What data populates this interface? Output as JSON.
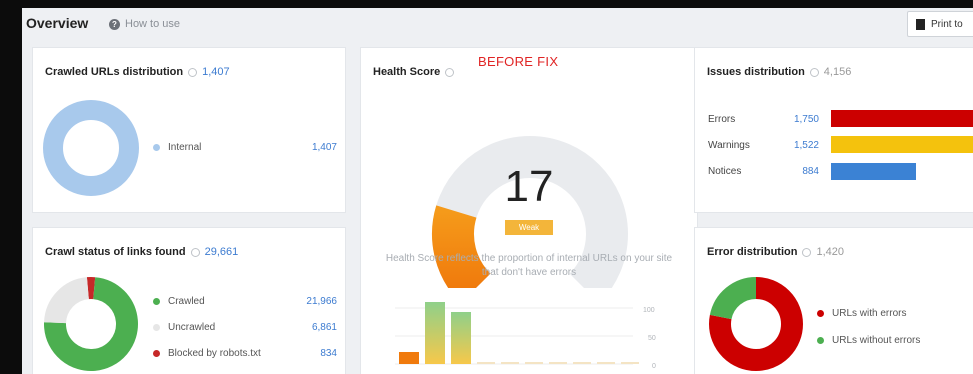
{
  "header": {
    "title": "Overview",
    "help_label": "How to use",
    "print_label": "Print to"
  },
  "crawled_urls": {
    "title": "Crawled URLs distribution",
    "count": "1,407",
    "legend": [
      {
        "label": "Internal",
        "value": "1,407",
        "color": "#a8c9ec"
      }
    ]
  },
  "crawl_status": {
    "title": "Crawl status of links found",
    "count": "29,661",
    "legend": [
      {
        "label": "Crawled",
        "value": "21,966",
        "color": "#4caf50"
      },
      {
        "label": "Uncrawled",
        "value": "6,861",
        "color": "#e6e6e6"
      },
      {
        "label": "Blocked by robots.txt",
        "value": "834",
        "color": "#c62828"
      }
    ]
  },
  "health": {
    "title": "Health Score",
    "annotation": "BEFORE FIX",
    "score": "17",
    "score_value": 17,
    "badge": "Weak",
    "description": "Health Score reflects the proportion of internal URLs on your site that don't have errors",
    "mini_ticks": [
      "100",
      "50",
      "0"
    ]
  },
  "issues": {
    "title": "Issues distribution",
    "count": "4,156",
    "rows": [
      {
        "label": "Errors",
        "value": "1,750",
        "color": "#cc0000"
      },
      {
        "label": "Warnings",
        "value": "1,522",
        "color": "#f4c20d"
      },
      {
        "label": "Notices",
        "value": "884",
        "color": "#3b82d4"
      }
    ]
  },
  "errors": {
    "title": "Error distribution",
    "count": "1,420",
    "legend": [
      {
        "label": "URLs with errors",
        "color": "#cc0000"
      },
      {
        "label": "URLs without errors",
        "color": "#4caf50"
      }
    ]
  },
  "colors": {
    "accent_blue": "#3c7bd0",
    "error_red": "#cc0000",
    "ok_green": "#4caf50",
    "weak_orange": "#f3b53a"
  }
}
